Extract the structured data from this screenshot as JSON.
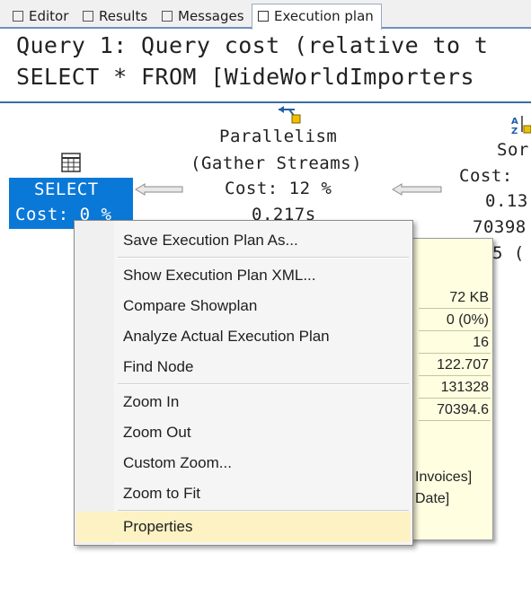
{
  "tabs": [
    {
      "label": "Editor",
      "icon": "editor-icon"
    },
    {
      "label": "Results",
      "icon": "grid-icon"
    },
    {
      "label": "Messages",
      "icon": "messages-icon"
    },
    {
      "label": "Execution plan",
      "icon": "execution-plan-icon"
    }
  ],
  "query": {
    "line1": "Query 1: Query cost (relative to t",
    "line2": "SELECT * FROM [WideWorldImporters"
  },
  "nodes": {
    "select": {
      "name": "SELECT",
      "cost": "Cost: 0 %",
      "icon": "table-icon"
    },
    "parallelism": {
      "name": "Parallelism",
      "sub": "(Gather Streams)",
      "cost": "Cost: 12 %",
      "time": "0.217s",
      "icon": "parallelism-icon"
    },
    "sort": {
      "name": "Sor",
      "cost": "Cost:",
      "val1": "0.13",
      "val2": "70398",
      "val3": "5 (",
      "icon": "sort-icon"
    }
  },
  "properties": {
    "values": [
      "72 KB",
      "0 (0%)",
      "16",
      "122.707",
      "131328",
      "70394.6"
    ],
    "text1": "Invoices]",
    "text2": "Date]"
  },
  "menu": {
    "items": [
      "Save Execution Plan As...",
      "Show Execution Plan XML...",
      "Compare Showplan",
      "Analyze Actual Execution Plan",
      "Find Node",
      "Zoom In",
      "Zoom Out",
      "Custom Zoom...",
      "Zoom to Fit",
      "Properties"
    ],
    "highlighted": "Properties"
  },
  "colors": {
    "accent": "#0a78d7",
    "tooltip_bg": "#fffee1",
    "menu_highlight": "#fdf2c4"
  }
}
